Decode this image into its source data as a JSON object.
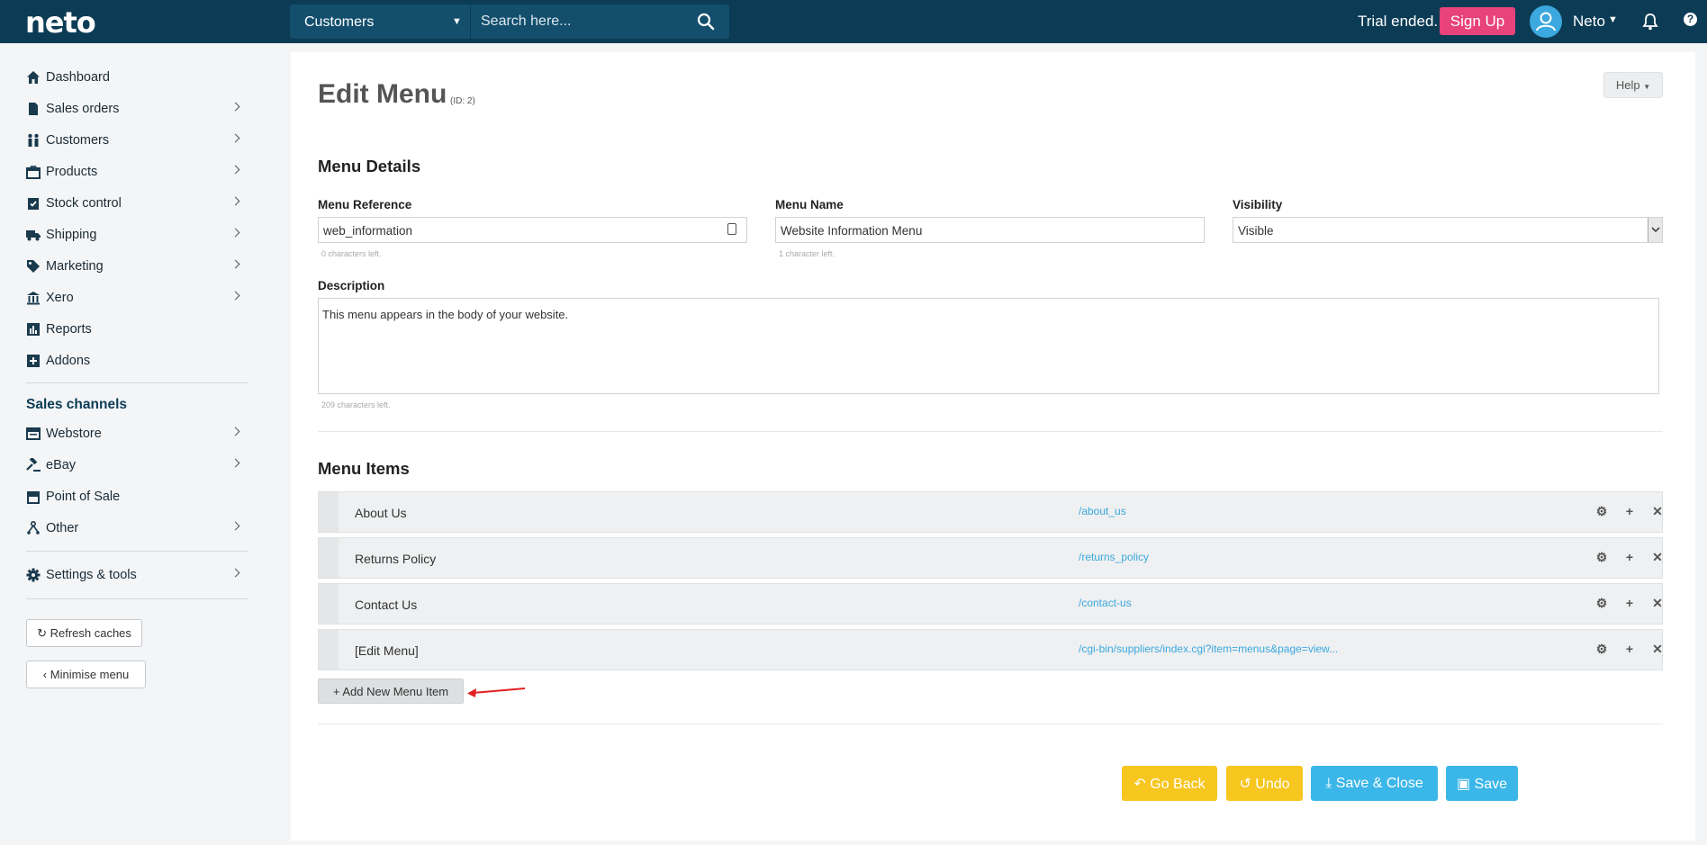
{
  "topbar": {
    "logo": "neto",
    "search_scope": "Customers",
    "search_placeholder": "Search here...",
    "trial_text": "Trial ended.",
    "signup_label": "Sign Up",
    "user_name": "Neto",
    "help_glyph": "?"
  },
  "sidebar": {
    "items": [
      {
        "label": "Dashboard",
        "icon": "home-icon"
      },
      {
        "label": "Sales orders",
        "icon": "document-icon"
      },
      {
        "label": "Customers",
        "icon": "users-icon"
      },
      {
        "label": "Products",
        "icon": "products-icon"
      },
      {
        "label": "Stock control",
        "icon": "clipboard-check-icon"
      },
      {
        "label": "Shipping",
        "icon": "truck-icon"
      },
      {
        "label": "Marketing",
        "icon": "tag-icon"
      },
      {
        "label": "Xero",
        "icon": "bank-icon"
      },
      {
        "label": "Reports",
        "icon": "bar-chart-icon"
      },
      {
        "label": "Addons",
        "icon": "plus-square-icon"
      }
    ],
    "sales_channels_title": "Sales channels",
    "channels": [
      {
        "label": "Webstore",
        "icon": "webstore-icon"
      },
      {
        "label": "eBay",
        "icon": "gavel-icon"
      },
      {
        "label": "Point of Sale",
        "icon": "store-icon"
      },
      {
        "label": "Other",
        "icon": "sitemap-icon"
      }
    ],
    "settings_label": "Settings & tools",
    "refresh_label": "Refresh caches",
    "minimise_label": "Minimise menu"
  },
  "page": {
    "title": "Edit Menu",
    "id_text": "(ID: 2)",
    "help_label": "Help"
  },
  "details": {
    "heading": "Menu Details",
    "reference_label": "Menu Reference",
    "reference_value": "web_information",
    "reference_hint": "0 characters left.",
    "name_label": "Menu Name",
    "name_value": "Website Information Menu",
    "name_hint": "1 character left.",
    "visibility_label": "Visibility",
    "visibility_value": "Visible",
    "description_label": "Description",
    "description_value": "This menu appears in the body of your website.",
    "description_hint": "209 characters left."
  },
  "menu_items": {
    "heading": "Menu Items",
    "rows": [
      {
        "name": "About Us",
        "url": "/about_us"
      },
      {
        "name": "Returns Policy",
        "url": "/returns_policy"
      },
      {
        "name": "Contact Us",
        "url": "/contact-us"
      },
      {
        "name": "[Edit Menu]",
        "url": "/cgi-bin/suppliers/index.cgi?item=menus&page=view..."
      }
    ],
    "add_label": "+ Add New Menu Item"
  },
  "actions": {
    "go_back": "Go Back",
    "undo": "Undo",
    "save_close": "Save & Close",
    "save": "Save"
  },
  "colors": {
    "topbar": "#0c3c55",
    "signup": "#e8437a",
    "link": "#3ba8df",
    "yellow_button": "#f7c61f",
    "blue_button": "#3bb6e8",
    "annotation_arrow": "#e02020"
  }
}
